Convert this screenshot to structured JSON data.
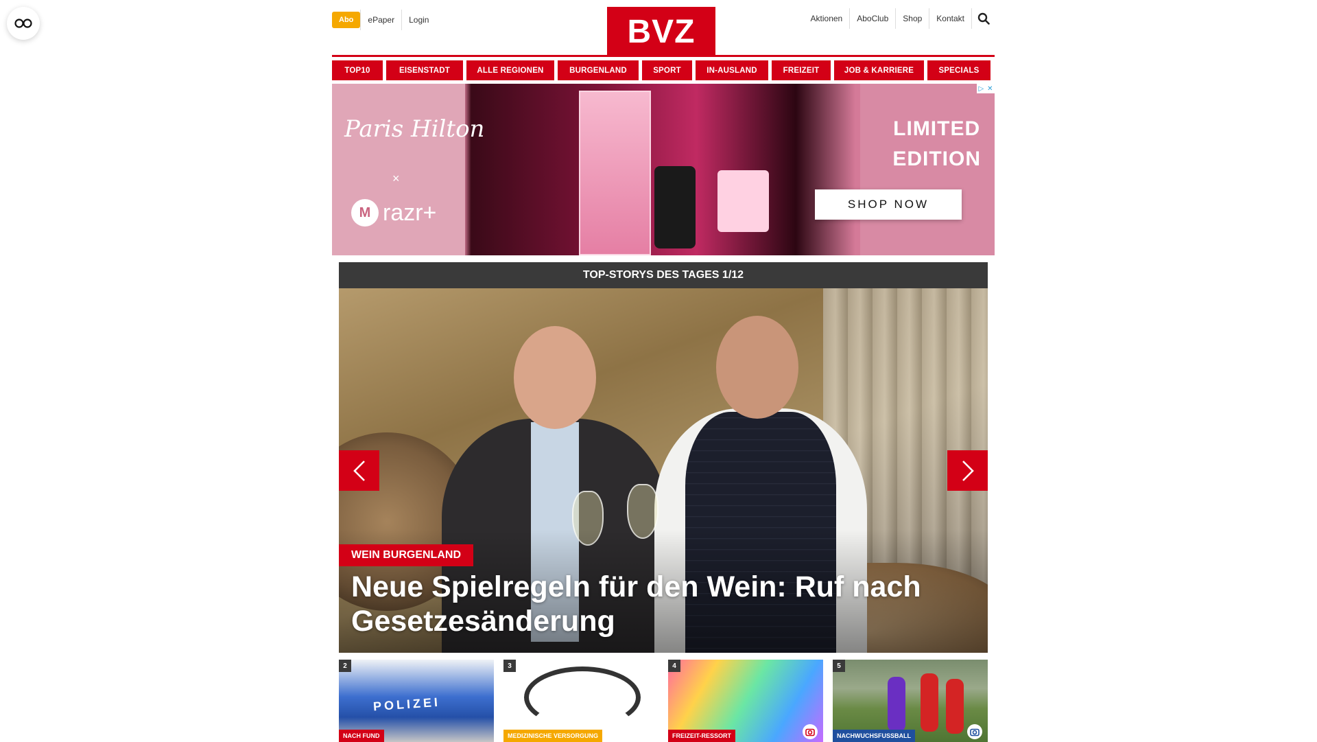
{
  "header": {
    "abo_label": "Abo",
    "left_links": [
      "ePaper",
      "Login"
    ],
    "logo": "BVZ",
    "right_links": [
      "Aktionen",
      "AboClub",
      "Shop",
      "Kontakt"
    ]
  },
  "nav": {
    "items": [
      "TOP10",
      "EISENSTADT",
      "ALLE REGIONEN",
      "BURGENLAND",
      "SPORT",
      "IN-AUSLAND",
      "FREIZEIT",
      "JOB & KARRIERE",
      "SPECIALS"
    ]
  },
  "ad": {
    "brand_script": "Paris Hilton",
    "times": "×",
    "partner": "razr+",
    "headline_line1": "LIMITED",
    "headline_line2": "EDITION",
    "cta": "SHOP NOW"
  },
  "top_stories": {
    "heading": "TOP-STORYS DES TAGES 1/12",
    "hero": {
      "kicker": "WEIN BURGENLAND",
      "title": "Neue Spielregeln für den Wein: Ruf nach Gesetzesänderung"
    },
    "teasers": [
      {
        "number": "2",
        "tag": "NACH FUND",
        "image_text": "POLIZEI"
      },
      {
        "number": "3",
        "tag": "MEDIZINISCHE VERSORGUNG"
      },
      {
        "number": "4",
        "tag": "FREIZEIT-RESSORT"
      },
      {
        "number": "5",
        "tag": "NACHWUCHSFUSSBALL"
      }
    ]
  },
  "colors": {
    "brand_red": "#d30016",
    "abo_yellow": "#f5a800",
    "dark_bar": "#3a3a3a"
  }
}
